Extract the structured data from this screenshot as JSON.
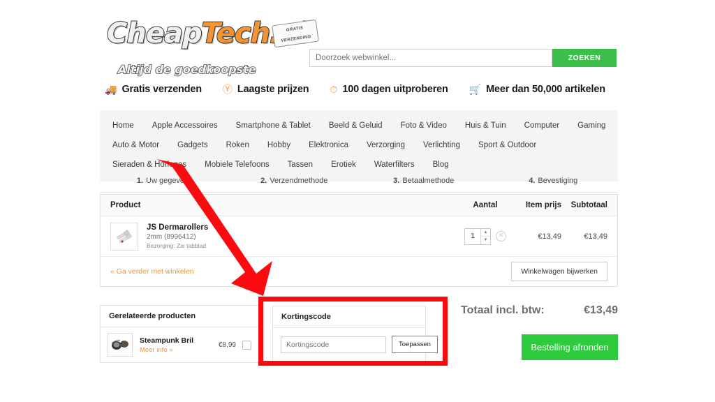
{
  "branding": {
    "logo_cheap": "Cheap",
    "logo_tech": "Tech.nl",
    "logo_tag_line1": "GRATIS",
    "logo_tag_line2": "VERZENDING",
    "tagline": "Altijd de goedkoopste",
    "accent_orange": "#f59433",
    "accent_green": "#3cbe4a"
  },
  "search": {
    "placeholder": "Doorzoek webwinkel...",
    "value": "",
    "button_label": "ZOEKEN"
  },
  "usps": [
    {
      "icon": "truck-icon",
      "label": "Gratis verzenden"
    },
    {
      "icon": "price-tag-icon",
      "label": "Laagste prijzen"
    },
    {
      "icon": "clock-icon",
      "label": "100 dagen uitproberen"
    },
    {
      "icon": "cart-icon",
      "label": "Meer dan 50,000 artikelen"
    }
  ],
  "nav": {
    "row1": [
      "Home",
      "Apple Accessoires",
      "Smartphone & Tablet",
      "Beeld & Geluid",
      "Foto & Video",
      "Huis & Tuin",
      "Computer",
      "Gaming"
    ],
    "row2": [
      "Auto & Motor",
      "Gadgets",
      "Roken",
      "Hobby",
      "Elektronica",
      "Verzorging",
      "Verlichting",
      "Sport & Outdoor"
    ],
    "row3": [
      "Sieraden & Horloges",
      "Mobiele Telefoons",
      "Tassen",
      "Erotiek",
      "Waterfilters",
      "Blog"
    ]
  },
  "steps": [
    {
      "num": "1.",
      "label": "Uw gegevens"
    },
    {
      "num": "2.",
      "label": "Verzendmethode"
    },
    {
      "num": "3.",
      "label": "Betaalmethode"
    },
    {
      "num": "4.",
      "label": "Bevestiging"
    }
  ],
  "cart": {
    "headers": {
      "product": "Product",
      "aantal": "Aantal",
      "item_prijs": "Item prijs",
      "subtotaal": "Subtotaal"
    },
    "rows": [
      {
        "name": "JS Dermarollers",
        "option": "2mm (8996412)",
        "shipping": "Bezorging: Zie tabblad",
        "qty": "1",
        "price": "€13,49",
        "subtotal": "€13,49"
      }
    ],
    "continue_link": "« Ga verder met winkelen",
    "update_button": "Winkelwagen bijwerken"
  },
  "related": {
    "title": "Gerelateerde producten",
    "items": [
      {
        "name": "Steampunk Bril",
        "more_link": "Meer info »",
        "price": "€8,99"
      }
    ]
  },
  "coupon": {
    "title": "Kortingscode",
    "placeholder": "Kortingscode",
    "value": "",
    "apply_button": "Toepassen"
  },
  "totals": {
    "label": "Totaal incl. btw:",
    "value": "€13,49",
    "order_button": "Bestelling afronden"
  },
  "annotations": {
    "highlight_color": "#fb0b10",
    "arrow_color": "#fb0b10"
  }
}
